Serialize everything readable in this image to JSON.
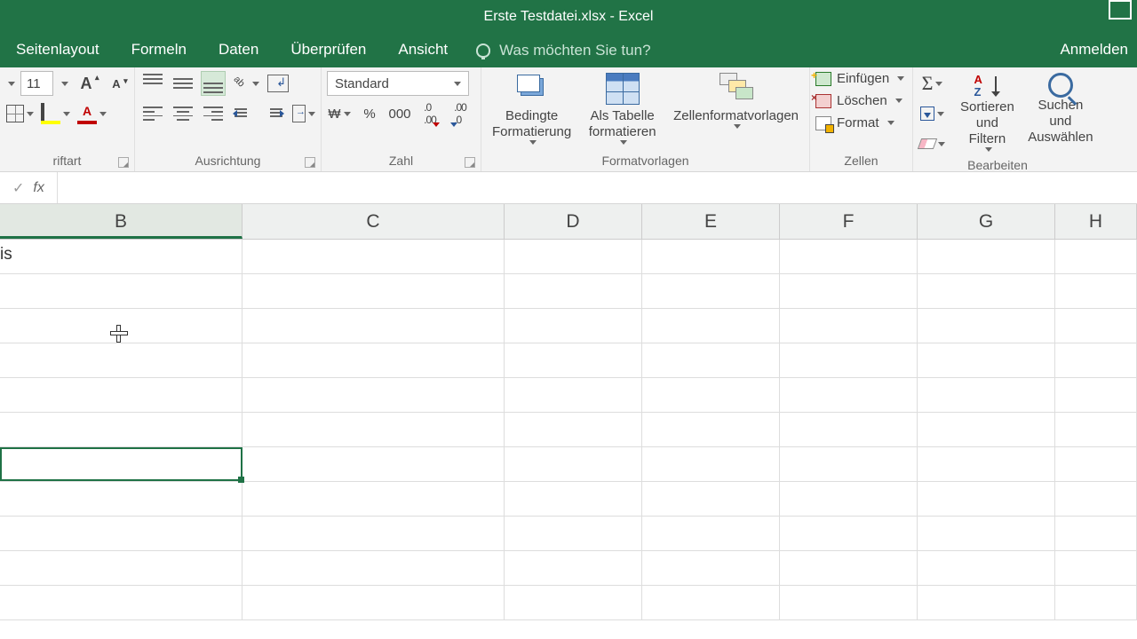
{
  "titlebar": {
    "title": "Erste Testdatei.xlsx - Excel"
  },
  "tabs": {
    "items": [
      "Seitenlayout",
      "Formeln",
      "Daten",
      "Überprüfen",
      "Ansicht"
    ],
    "tellme": "Was möchten Sie tun?",
    "login": "Anmelden"
  },
  "ribbon": {
    "font": {
      "size": "11",
      "label": "riftart"
    },
    "alignment": {
      "label": "Ausrichtung"
    },
    "number": {
      "format": "Standard",
      "label": "Zahl",
      "percent": "%",
      "thousand": "000",
      "curr": "₩"
    },
    "styles": {
      "cond": "Bedingte Formatierung",
      "table": "Als Tabelle formatieren",
      "cell": "Zellenformatvorlagen",
      "label": "Formatvorlagen"
    },
    "cells": {
      "insert": "Einfügen",
      "delete": "Löschen",
      "format": "Format",
      "label": "Zellen"
    },
    "editing": {
      "sort": "Sortieren und Filtern",
      "find": "Suchen und Auswählen",
      "label": "Bearbeiten"
    }
  },
  "formula_bar": {
    "fx": "fx",
    "value": ""
  },
  "grid": {
    "columns": [
      "B",
      "C",
      "D",
      "E",
      "F",
      "G",
      "H"
    ],
    "cell_b1": "is"
  }
}
